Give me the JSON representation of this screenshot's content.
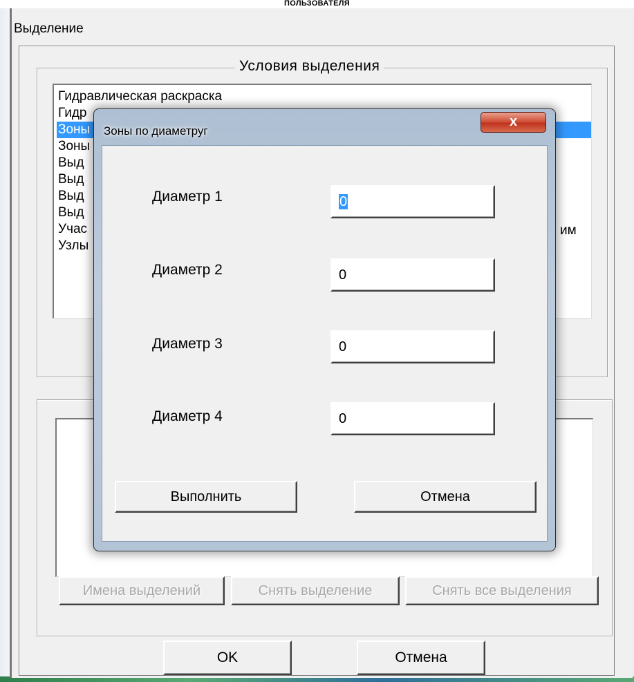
{
  "header": {
    "caption": "ПОЛЬЗОВАТЕЛЯ"
  },
  "main_dialog": {
    "title": "Выделение",
    "conditions_group_label": "Условия  выделения",
    "conditions": [
      "Гидравлическая раскраска",
      "Гидр",
      "Зоны",
      "Зоны",
      "Выд",
      "Выд",
      "Выд",
      "Выд",
      "Учас",
      "Узлы"
    ],
    "selected_condition_index": 2,
    "condition_tail_text": "им",
    "buttons": {
      "selection_names": "Имена выделений",
      "unselect": "Снять  выделение",
      "unselect_all": "Снять все выделения",
      "ok": "OK",
      "cancel": "Отмена"
    }
  },
  "modal": {
    "title": "Зоны по диаметруг",
    "close_label": "x",
    "fields": [
      {
        "label": "Диаметр 1",
        "value": "0",
        "focused": true
      },
      {
        "label": "Диаметр 2",
        "value": "0",
        "focused": false
      },
      {
        "label": "Диаметр 3",
        "value": "0",
        "focused": false
      },
      {
        "label": "Диаметр 4",
        "value": "0",
        "focused": false
      }
    ],
    "execute_label": "Выполнить",
    "cancel_label": "Отмена"
  }
}
